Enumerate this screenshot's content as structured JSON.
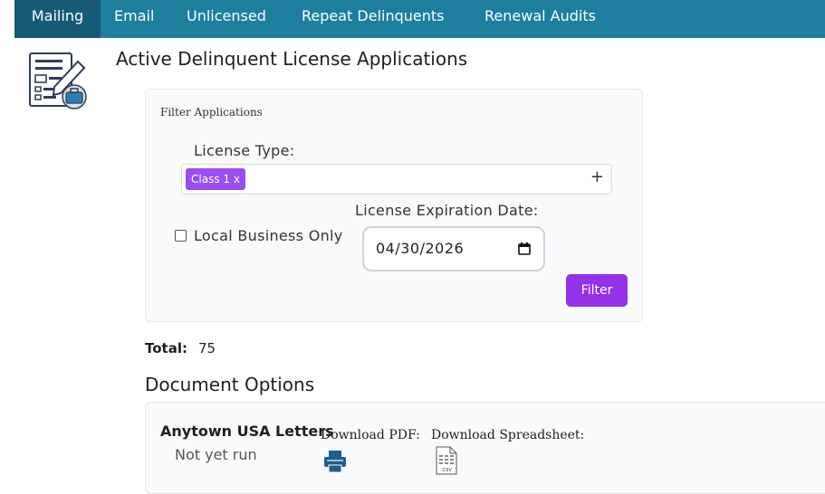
{
  "nav": {
    "tabs": [
      {
        "label": "Mailing",
        "active": true
      },
      {
        "label": "Email",
        "active": false
      },
      {
        "label": "Unlicensed",
        "active": false
      },
      {
        "label": "Repeat Delinquents",
        "active": false
      },
      {
        "label": "Renewal Audits",
        "active": false
      }
    ]
  },
  "header": {
    "title": "Active Delinquent License Applications",
    "icon": "form-briefcase-icon"
  },
  "filter": {
    "heading": "Filter Applications",
    "license_type_label": "License Type:",
    "selected_chip": "Class 1 x",
    "add_icon": "+",
    "local_business_label": "Local Business Only",
    "local_business_checked": false,
    "expiration_label": "License Expiration Date:",
    "expiration_value": "04/30/2026",
    "filter_button": "Filter"
  },
  "total": {
    "label": "Total:",
    "value": "75"
  },
  "documents": {
    "heading": "Document Options",
    "items": [
      {
        "name": "Anytown USA Letters",
        "status": "Not yet run",
        "pdf_label": "Download PDF:",
        "csv_label": "Download Spreadsheet:",
        "pdf_icon": "printer-icon",
        "csv_icon": "csv-file-icon"
      }
    ]
  },
  "colors": {
    "nav_bg": "#1e7e9e",
    "nav_active": "#175a76",
    "accent_purple": "#9332e6",
    "chip_purple": "#9a4ef1"
  }
}
